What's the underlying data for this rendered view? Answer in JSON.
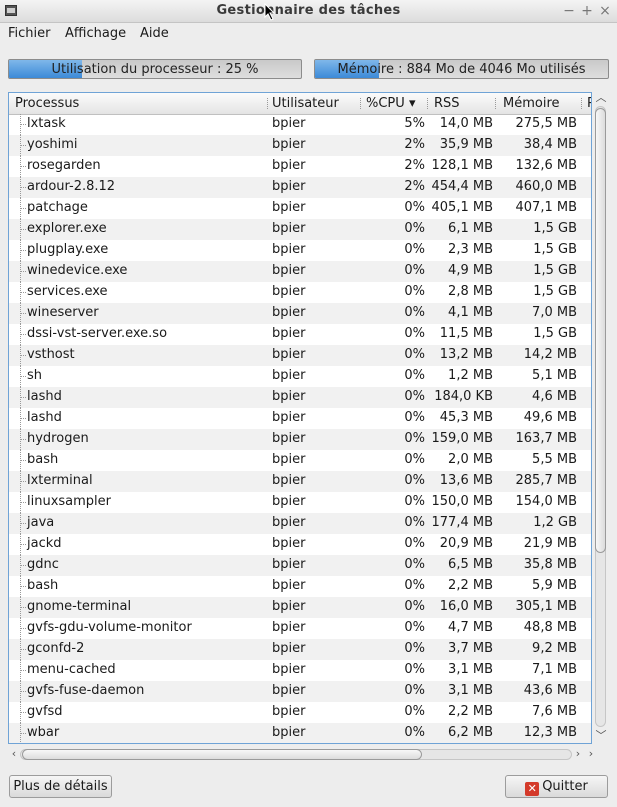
{
  "window": {
    "title": "Gestionnaire des tâches",
    "minimize": "−",
    "maximize": "+",
    "close": "×"
  },
  "menu": [
    "Fichier",
    "Affichage",
    "Aide"
  ],
  "cpu_bar": {
    "label": "Utilisation du processeur : 25 %",
    "percent": 25
  },
  "mem_bar": {
    "label": "Mémoire : 884 Mo de 4046 Mo utilisés",
    "percent": 21.8
  },
  "columns": {
    "process": "Processus",
    "user": "Utilisateur",
    "cpu": "%CPU",
    "sort_indicator": "▾",
    "rss": "RSS",
    "memory": "Mémoire",
    "extra": "P"
  },
  "processes": [
    {
      "name": "lxtask",
      "user": "bpier",
      "cpu": "5%",
      "rss": "14,0 MB",
      "mem": "275,5 MB"
    },
    {
      "name": "yoshimi",
      "user": "bpier",
      "cpu": "2%",
      "rss": "35,9 MB",
      "mem": "38,4 MB"
    },
    {
      "name": "rosegarden",
      "user": "bpier",
      "cpu": "2%",
      "rss": "128,1 MB",
      "mem": "132,6 MB"
    },
    {
      "name": "ardour-2.8.12",
      "user": "bpier",
      "cpu": "2%",
      "rss": "454,4 MB",
      "mem": "460,0 MB"
    },
    {
      "name": "patchage",
      "user": "bpier",
      "cpu": "0%",
      "rss": "405,1 MB",
      "mem": "407,1 MB"
    },
    {
      "name": "explorer.exe",
      "user": "bpier",
      "cpu": "0%",
      "rss": "6,1 MB",
      "mem": "1,5 GB"
    },
    {
      "name": "plugplay.exe",
      "user": "bpier",
      "cpu": "0%",
      "rss": "2,3 MB",
      "mem": "1,5 GB"
    },
    {
      "name": "winedevice.exe",
      "user": "bpier",
      "cpu": "0%",
      "rss": "4,9 MB",
      "mem": "1,5 GB"
    },
    {
      "name": "services.exe",
      "user": "bpier",
      "cpu": "0%",
      "rss": "2,8 MB",
      "mem": "1,5 GB"
    },
    {
      "name": "wineserver",
      "user": "bpier",
      "cpu": "0%",
      "rss": "4,1 MB",
      "mem": "7,0 MB"
    },
    {
      "name": "dssi-vst-server.exe.so",
      "user": "bpier",
      "cpu": "0%",
      "rss": "11,5 MB",
      "mem": "1,5 GB"
    },
    {
      "name": "vsthost",
      "user": "bpier",
      "cpu": "0%",
      "rss": "13,2 MB",
      "mem": "14,2 MB"
    },
    {
      "name": "sh",
      "user": "bpier",
      "cpu": "0%",
      "rss": "1,2 MB",
      "mem": "5,1 MB"
    },
    {
      "name": "lashd",
      "user": "bpier",
      "cpu": "0%",
      "rss": "184,0 KB",
      "mem": "4,6 MB"
    },
    {
      "name": "lashd",
      "user": "bpier",
      "cpu": "0%",
      "rss": "45,3 MB",
      "mem": "49,6 MB"
    },
    {
      "name": "hydrogen",
      "user": "bpier",
      "cpu": "0%",
      "rss": "159,0 MB",
      "mem": "163,7 MB"
    },
    {
      "name": "bash",
      "user": "bpier",
      "cpu": "0%",
      "rss": "2,0 MB",
      "mem": "5,5 MB"
    },
    {
      "name": "lxterminal",
      "user": "bpier",
      "cpu": "0%",
      "rss": "13,6 MB",
      "mem": "285,7 MB"
    },
    {
      "name": "linuxsampler",
      "user": "bpier",
      "cpu": "0%",
      "rss": "150,0 MB",
      "mem": "154,0 MB"
    },
    {
      "name": "java",
      "user": "bpier",
      "cpu": "0%",
      "rss": "177,4 MB",
      "mem": "1,2 GB"
    },
    {
      "name": "jackd",
      "user": "bpier",
      "cpu": "0%",
      "rss": "20,9 MB",
      "mem": "21,9 MB"
    },
    {
      "name": "gdnc",
      "user": "bpier",
      "cpu": "0%",
      "rss": "6,5 MB",
      "mem": "35,8 MB"
    },
    {
      "name": "bash",
      "user": "bpier",
      "cpu": "0%",
      "rss": "2,2 MB",
      "mem": "5,9 MB"
    },
    {
      "name": "gnome-terminal",
      "user": "bpier",
      "cpu": "0%",
      "rss": "16,0 MB",
      "mem": "305,1 MB"
    },
    {
      "name": "gvfs-gdu-volume-monitor",
      "user": "bpier",
      "cpu": "0%",
      "rss": "4,7 MB",
      "mem": "48,8 MB"
    },
    {
      "name": "gconfd-2",
      "user": "bpier",
      "cpu": "0%",
      "rss": "3,7 MB",
      "mem": "9,2 MB"
    },
    {
      "name": "menu-cached",
      "user": "bpier",
      "cpu": "0%",
      "rss": "3,1 MB",
      "mem": "7,1 MB"
    },
    {
      "name": "gvfs-fuse-daemon",
      "user": "bpier",
      "cpu": "0%",
      "rss": "3,1 MB",
      "mem": "43,6 MB"
    },
    {
      "name": "gvfsd",
      "user": "bpier",
      "cpu": "0%",
      "rss": "2,2 MB",
      "mem": "7,6 MB"
    },
    {
      "name": "wbar",
      "user": "bpier",
      "cpu": "0%",
      "rss": "6,2 MB",
      "mem": "12,3 MB"
    }
  ],
  "buttons": {
    "details": "Plus de détails",
    "quit": "Quitter",
    "quit_icon": "✕"
  },
  "colors": {
    "progress_fill": "#3c8ad8",
    "quit_icon": "#d43a2a",
    "selection_border": "#6fa3d6"
  }
}
